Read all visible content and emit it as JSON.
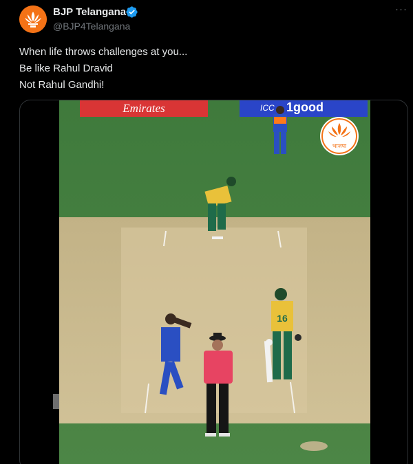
{
  "author": {
    "name": "BJP Telangana",
    "handle": "@BJP4Telangana",
    "avatar_icon": "lotus-icon",
    "verified": true
  },
  "menu": {
    "label": "···"
  },
  "tweet": {
    "lines": [
      "When life throws challenges at you...",
      "Be like Rahul Dravid",
      "Not Rahul Gandhi!"
    ]
  },
  "video": {
    "banners": {
      "left": "Emirates",
      "right_prefix": "ICC",
      "right": "1good"
    },
    "watermark_icon": "bjp-lotus-icon",
    "watermark_text": "भाजपा",
    "jersey_number": "16"
  },
  "colors": {
    "background": "#000000",
    "text": "#e7e9ea",
    "muted": "#71767b",
    "verified": "#1d9bf0",
    "avatar": "#f47216"
  }
}
